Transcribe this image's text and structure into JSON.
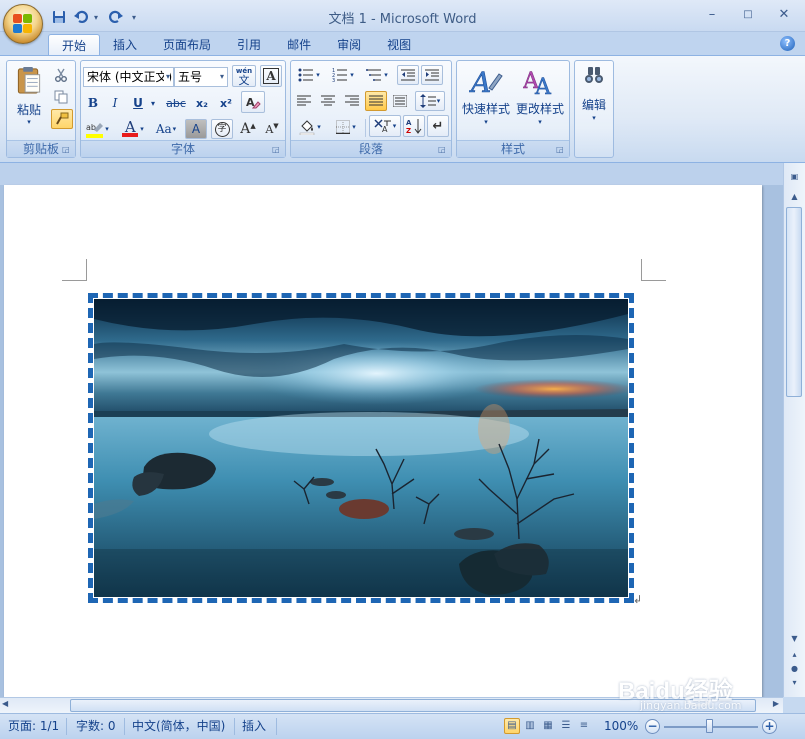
{
  "window": {
    "title": "文档 1 - Microsoft Word",
    "minimize_glyph": "–",
    "maximize_glyph": "□",
    "close_glyph": "✕"
  },
  "quick_access": {
    "icons": [
      "save-icon",
      "undo-icon",
      "redo-icon",
      "customize-icon"
    ]
  },
  "tabs": [
    {
      "label": "开始",
      "active": true
    },
    {
      "label": "插入",
      "active": false
    },
    {
      "label": "页面布局",
      "active": false
    },
    {
      "label": "引用",
      "active": false
    },
    {
      "label": "邮件",
      "active": false
    },
    {
      "label": "审阅",
      "active": false
    },
    {
      "label": "视图",
      "active": false
    }
  ],
  "ribbon": {
    "clipboard": {
      "label": "剪贴板",
      "paste_label": "粘贴"
    },
    "font": {
      "label": "字体",
      "font_name": "宋体 (中文正文)",
      "font_size": "五号",
      "bold": "B",
      "italic": "I",
      "underline": "U",
      "strikethrough": "abc",
      "subscript": "x₂",
      "superscript": "x²",
      "font_color_glyph": "A",
      "change_case": "Aa",
      "char_shading": "A",
      "grow_font": "A",
      "shrink_font": "A",
      "clear_format": "A",
      "phonetic": "wén",
      "phonetic_char": "文",
      "enclose": "字"
    },
    "paragraph": {
      "label": "段落"
    },
    "styles": {
      "label": "样式",
      "quick_styles": "快速样式",
      "change_styles": "更改样式"
    },
    "editing": {
      "label": "编辑"
    }
  },
  "document": {
    "paragraph_mark": "↲"
  },
  "statusbar": {
    "page": "页面: 1/1",
    "words": "字数: 0",
    "language": "中文(简体，中国)",
    "mode": "插入",
    "zoom": "100%",
    "zoom_minus": "−",
    "zoom_plus": "+"
  },
  "watermark": {
    "brand": "Baidu经验",
    "url": "jingyan.baidu.com"
  },
  "colors": {
    "accent": "#15428b",
    "frame_border": "#1e66b4",
    "ribbon_bg": "#dfe9f6"
  }
}
